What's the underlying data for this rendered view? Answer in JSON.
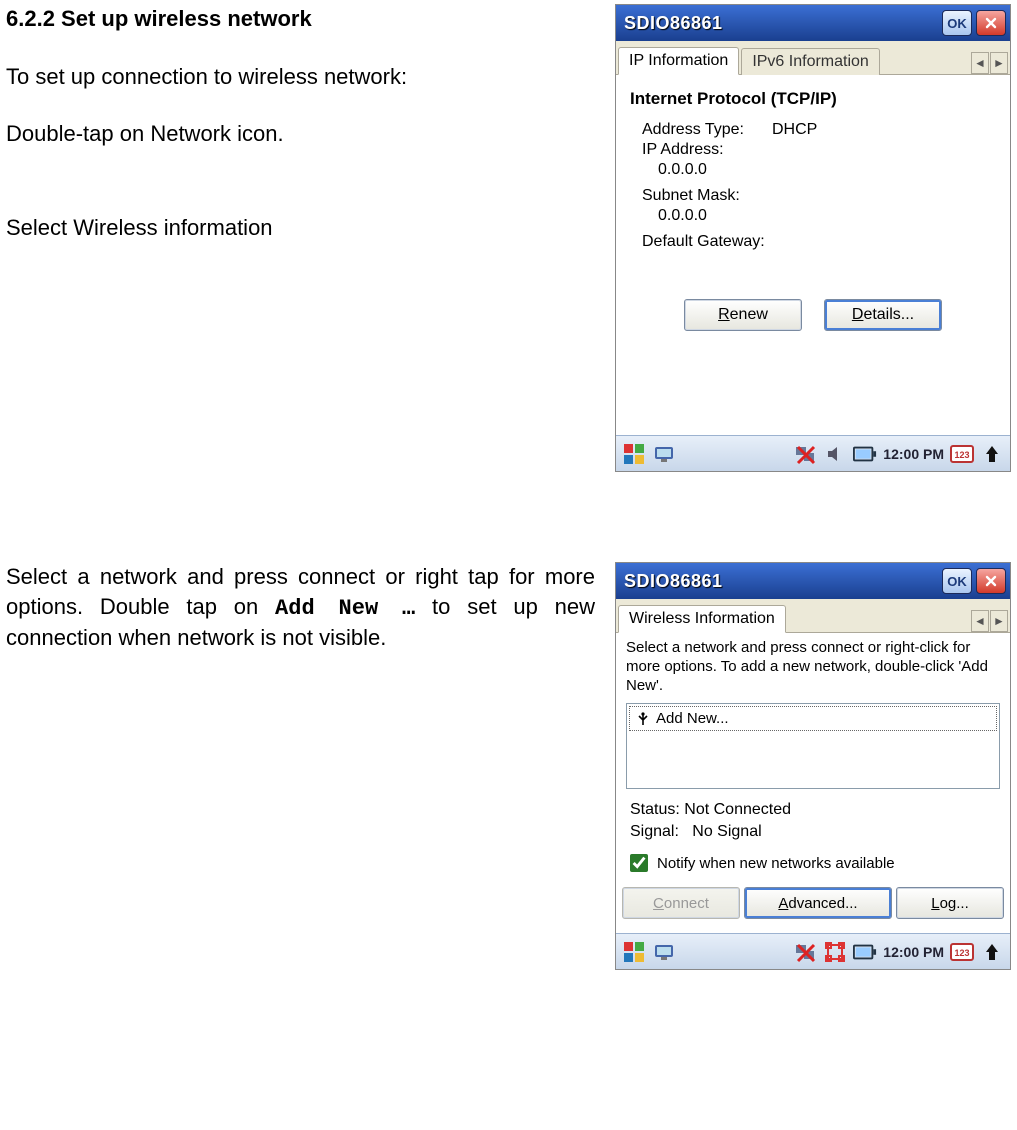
{
  "doc": {
    "heading": "6.2.2 Set up wireless network",
    "p1": "To set up connection to wireless network:",
    "p2": "Double-tap on Network icon.",
    "p3": "Select Wireless information",
    "p4_pre": "Select a network and press connect or right tap for more options. Double tap on ",
    "p4_mono": "Add New …",
    "p4_post": " to set up new connection when network is not visible."
  },
  "shot1": {
    "title": "SDIO86861",
    "ok": "OK",
    "tabs": {
      "active": "IP Information",
      "other": "IPv6 Information"
    },
    "panel_title": "Internet Protocol (TCP/IP)",
    "addr_type_label": "Address Type:",
    "addr_type_value": "DHCP",
    "ip_label": "IP Address:",
    "ip_value": "0.0.0.0",
    "subnet_label": "Subnet Mask:",
    "subnet_value": "0.0.0.0",
    "gateway_label": "Default Gateway:",
    "renew_btn_u": "R",
    "renew_btn_rest": "enew",
    "details_btn_u": "D",
    "details_btn_rest": "etails...",
    "clock": "12:00 PM"
  },
  "shot2": {
    "title": "SDIO86861",
    "ok": "OK",
    "tab": "Wireless Information",
    "instructions": "Select a network and press connect or right-click for more options.  To add a new network, double-click 'Add New'.",
    "add_new": "Add New...",
    "status_label": "Status:",
    "status_value": "Not Connected",
    "signal_label": "Signal:",
    "signal_value": "No Signal",
    "notify_label": "Notify when new networks available",
    "connect_btn_u": "C",
    "connect_btn_rest": "onnect",
    "advanced_btn_u": "A",
    "advanced_btn_rest": "dvanced...",
    "log_btn_u": "L",
    "log_btn_rest": "og...",
    "clock": "12:00 PM"
  }
}
